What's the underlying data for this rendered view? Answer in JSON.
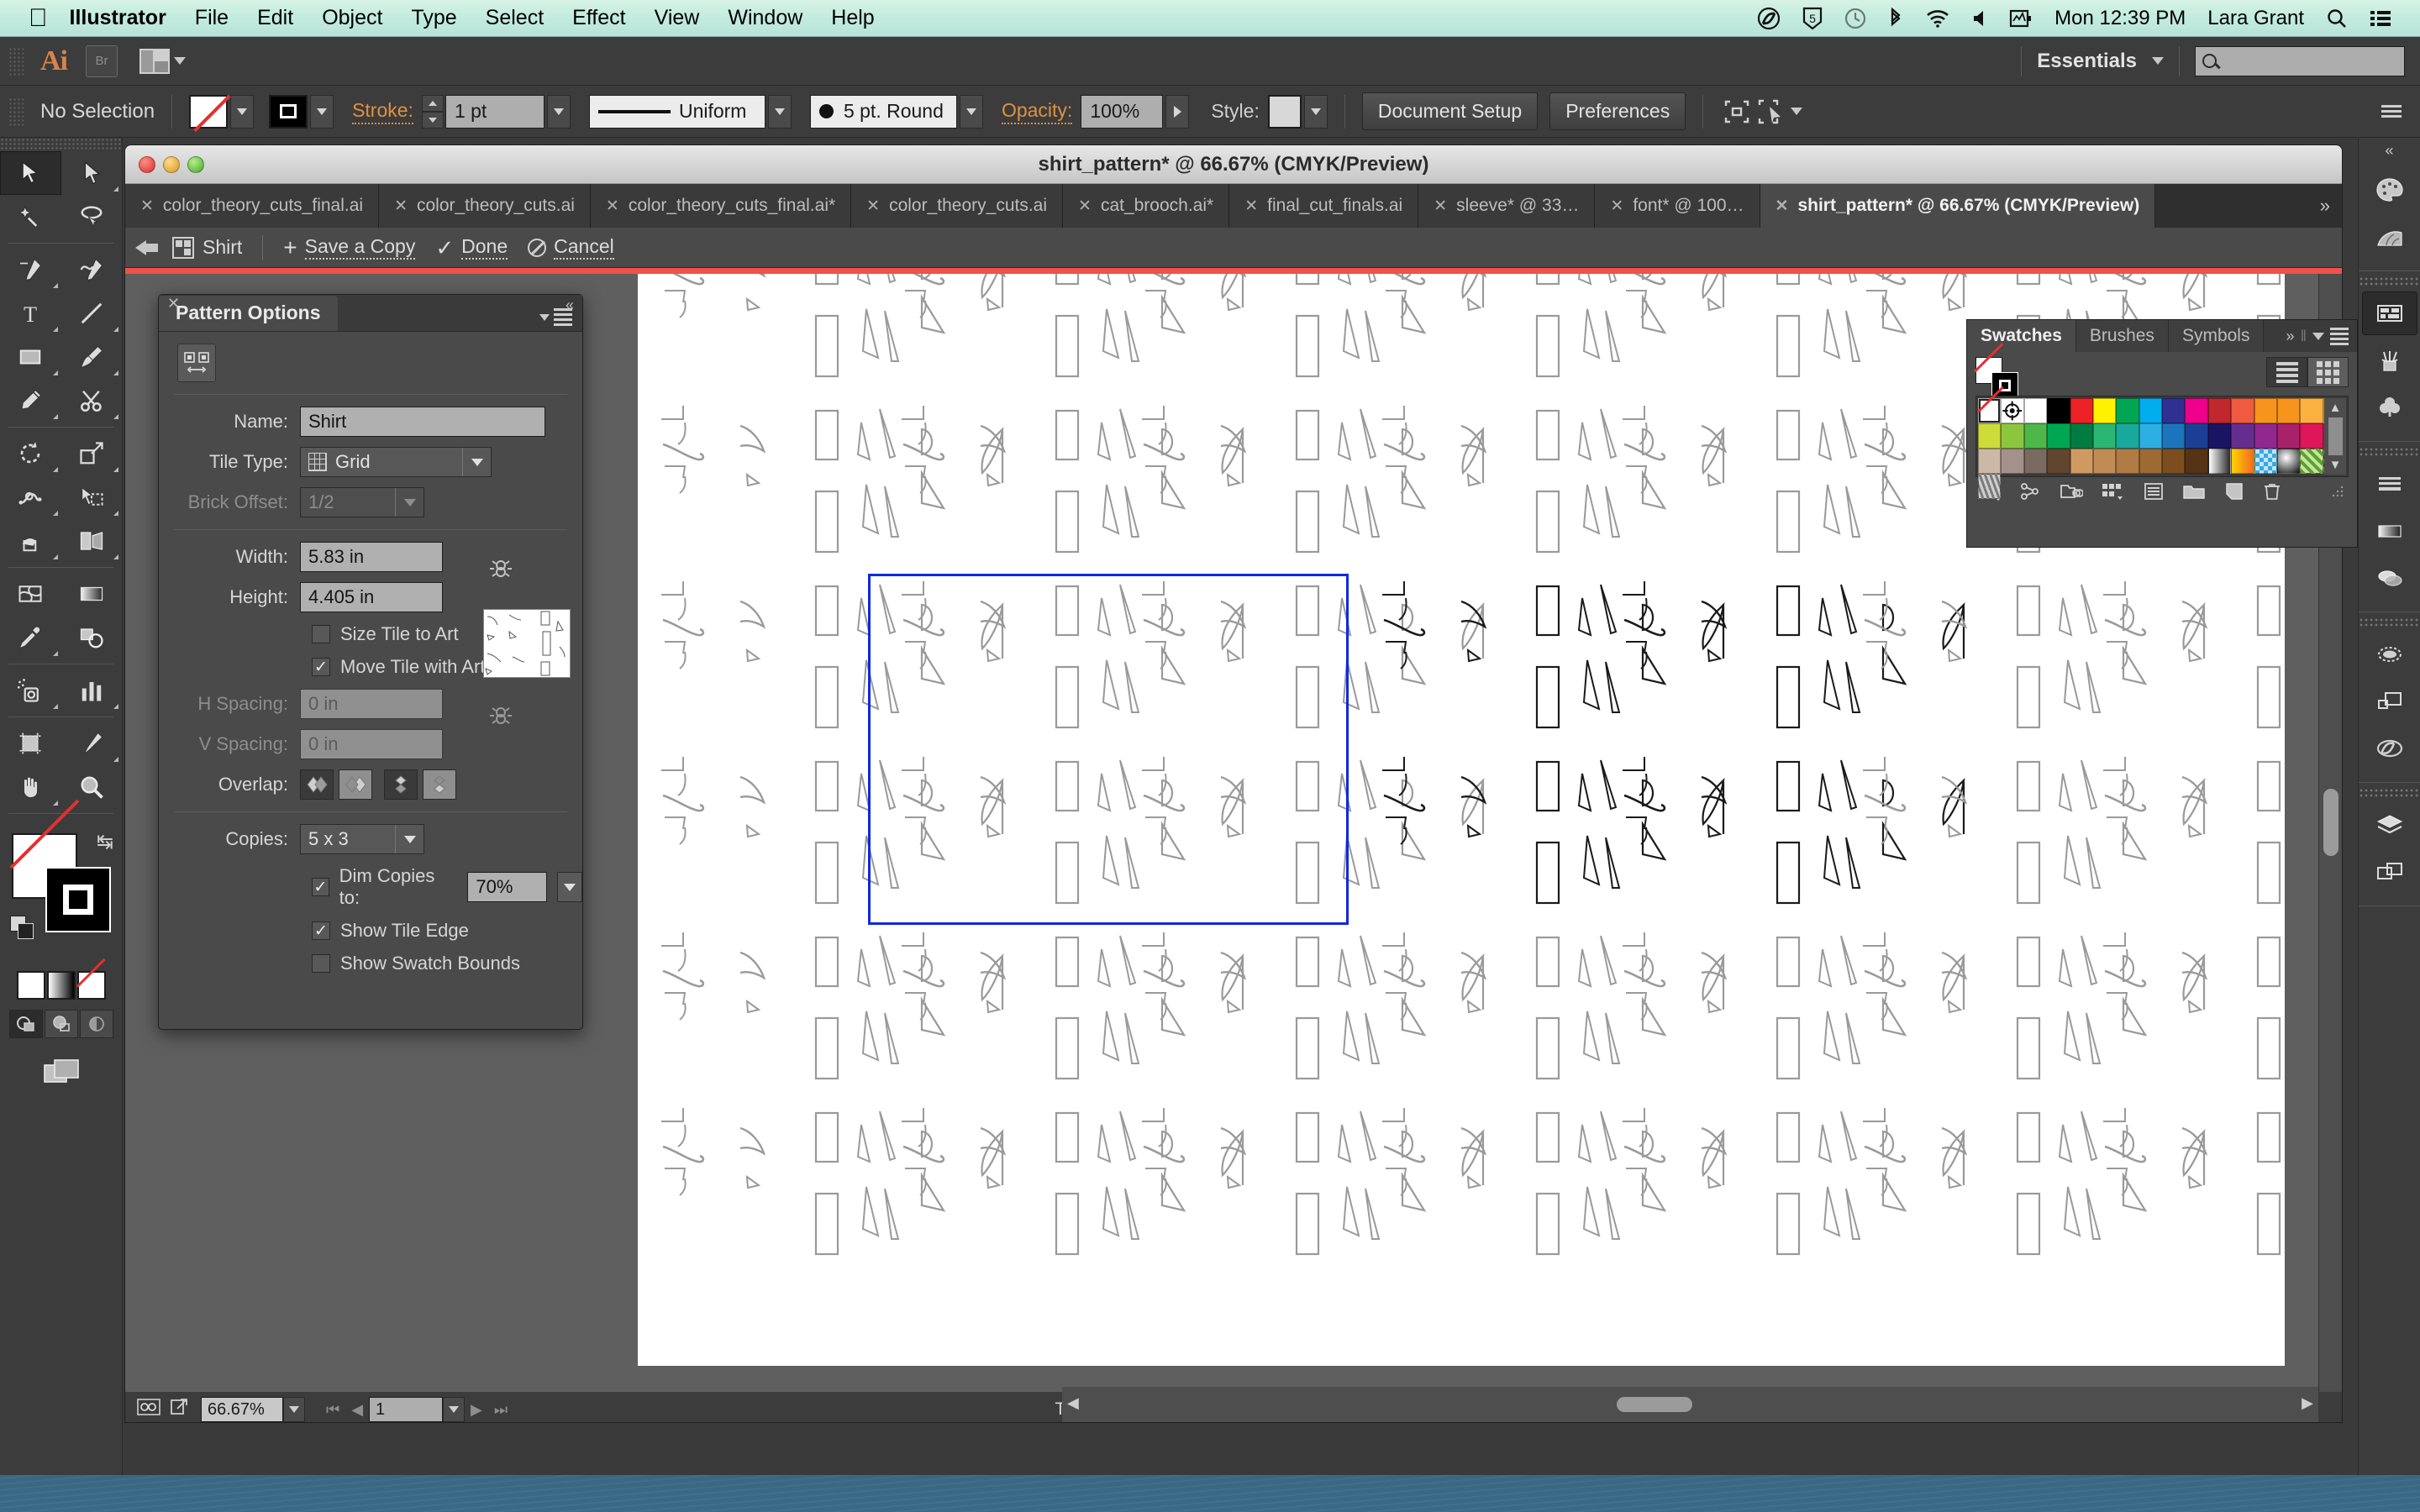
{
  "macbar": {
    "apple": "apple-logo",
    "menus": [
      "Illustrator",
      "File",
      "Edit",
      "Object",
      "Type",
      "Select",
      "Effect",
      "View",
      "Window",
      "Help"
    ],
    "status_icons": [
      "creative-cloud-icon",
      "shield-5-icon",
      "time-machine-icon",
      "bluetooth-icon",
      "wifi-icon",
      "volume-icon",
      "activity-monitor-icon"
    ],
    "clock": "Mon 12:39 PM",
    "user": "Lara Grant",
    "search_icon": "spotlight-search-icon",
    "notification_icon": "notification-center-icon"
  },
  "appbar": {
    "logo": "Ai",
    "bridge_label": "Br",
    "arrange_icon": "arrange-documents-icon",
    "workspace": "Essentials",
    "search_placeholder": ""
  },
  "control_bar": {
    "selection_status": "No Selection",
    "fill_label": "fill-swatch",
    "stroke_color_label": "stroke-swatch",
    "stroke_label": "Stroke:",
    "stroke_weight": "1 pt",
    "stroke_profile": "Uniform",
    "brush_definition": "5 pt. Round",
    "opacity_label": "Opacity:",
    "opacity_value": "100%",
    "style_label": "Style:",
    "document_setup": "Document Setup",
    "preferences": "Preferences",
    "transform_icon": "transform-icon",
    "align_icon": "align-icon"
  },
  "document_window": {
    "title": "shirt_pattern* @ 66.67% (CMYK/Preview)",
    "tabs": [
      {
        "label": "color_theory_cuts_final.ai",
        "active": false
      },
      {
        "label": "color_theory_cuts.ai",
        "active": false
      },
      {
        "label": "color_theory_cuts_final.ai*",
        "active": false
      },
      {
        "label": "color_theory_cuts.ai",
        "active": false
      },
      {
        "label": "cat_brooch.ai*",
        "active": false
      },
      {
        "label": "final_cut_finals.ai",
        "active": false
      },
      {
        "label": "sleeve* @ 33…",
        "active": false
      },
      {
        "label": "font* @ 100…",
        "active": false
      },
      {
        "label": "shirt_pattern* @ 66.67% (CMYK/Preview)",
        "active": true
      }
    ],
    "tab_close": "✕",
    "tab_overflow": "»"
  },
  "pattern_edit_bar": {
    "back_icon": "back-arrow-icon",
    "pattern_icon": "pattern-tile-icon",
    "pattern_name": "Shirt",
    "save_copy": "Save a Copy",
    "done": "Done",
    "cancel": "Cancel"
  },
  "pattern_options": {
    "panel_title": "Pattern Options",
    "close_icon": "close-icon",
    "collapse_icon": "collapse-icon",
    "menu_icon": "panel-menu-icon",
    "tile_tool_icon": "pattern-tile-tool-icon",
    "fields": {
      "name_label": "Name:",
      "name_value": "Shirt",
      "tile_type_label": "Tile Type:",
      "tile_type_value": "Grid",
      "brick_offset_label": "Brick Offset:",
      "brick_offset_value": "1/2",
      "width_label": "Width:",
      "width_value": "5.83 in",
      "height_label": "Height:",
      "height_value": "4.405 in",
      "h_spacing_label": "H Spacing:",
      "h_spacing_value": "0 in",
      "v_spacing_label": "V Spacing:",
      "v_spacing_value": "0 in",
      "overlap_label": "Overlap:",
      "copies_label": "Copies:",
      "copies_value": "5 x 3",
      "dim_copies_label": "Dim Copies to:",
      "dim_copies_value": "70%"
    },
    "checkboxes": [
      {
        "label": "Size Tile to Art",
        "checked": false
      },
      {
        "label": "Move Tile with Art",
        "checked": true
      },
      {
        "label": "Dim Copies to:",
        "checked": true
      },
      {
        "label": "Show Tile Edge",
        "checked": true
      },
      {
        "label": "Show Swatch Bounds",
        "checked": false
      }
    ],
    "overlap_buttons": [
      "overlap-left-icon",
      "overlap-right-icon",
      "overlap-top-icon",
      "overlap-bottom-icon"
    ],
    "link_icon": "link-dimensions-icon"
  },
  "swatches_panel": {
    "tabs": [
      "Swatches",
      "Brushes",
      "Symbols"
    ],
    "active_tab": "Swatches",
    "expand_icon": "expand-panels-icon",
    "menu_icon": "panel-menu-icon",
    "view_list_icon": "list-view-icon",
    "view_grid_icon": "grid-view-icon",
    "fill_icon": "fill-none-swatch",
    "stroke_icon": "stroke-black-swatch",
    "colors": [
      "none",
      "registration",
      "#ffffff",
      "#000000",
      "#ec2227",
      "#fff200",
      "#00a651",
      "#00aeef",
      "#2e3192",
      "#ec008c",
      "#c1272d",
      "#f05a40",
      "#f7941e",
      "#f7941e",
      "#fbb040",
      "#f9ed32",
      "#cddc39",
      "#8cc63f",
      "#4cb84a",
      "#00a651",
      "#007c42",
      "#2bb673",
      "#17a99c",
      "#2eafe4",
      "#1b75bc",
      "#1b3f94",
      "#1b1464",
      "#662d91",
      "#92278f",
      "#a8216b",
      "#e0165b",
      "#ec1f8d",
      "#cbb9a5",
      "#a3918a",
      "#7b6a5f",
      "#62452f",
      "#cf9a62",
      "#c08c54",
      "#b07a44",
      "#9d6a34",
      "#7c4e1e",
      "#563314",
      "gradient-white-black",
      "gradient-yellow-orange",
      "pattern-blue-checks",
      "pattern-sphere",
      "pattern-green-leaves",
      "pattern-brown-scroll",
      "pattern-camouflage"
    ],
    "footer_icons": [
      "swatch-libraries-icon",
      "color-group-icon",
      "link-libraries-icon",
      "show-kinds-icon",
      "swatch-options-icon",
      "new-color-group-icon",
      "new-swatch-icon",
      "delete-swatch-icon"
    ],
    "scroll_up_icon": "scroll-up-arrow",
    "scroll_down_icon": "scroll-down-arrow"
  },
  "icon_dock": {
    "groups": [
      [
        "color-palette-icon",
        "color-guide-icon"
      ],
      [
        "artboards-icon",
        "brushes-jar-icon",
        "symbols-clover-icon"
      ],
      [
        "stroke-lines-icon",
        "gradient-icon",
        "transparency-icon"
      ],
      [
        "appearance-ellipse-icon",
        "graphic-styles-icon",
        "creative-cloud-libraries-icon"
      ],
      [
        "layers-icon",
        "artboards-panel-icon"
      ]
    ],
    "collapse_icon": "collapse-dock-icon"
  },
  "tool_panel": {
    "tools": [
      {
        "name": "selection-tool",
        "glyph": "selection",
        "selected": true,
        "flyout": false
      },
      {
        "name": "direct-selection-tool",
        "glyph": "direct-selection",
        "selected": false,
        "flyout": true
      },
      {
        "name": "magic-wand-tool",
        "glyph": "magic-wand",
        "selected": false,
        "flyout": false
      },
      {
        "name": "lasso-tool",
        "glyph": "lasso",
        "selected": false,
        "flyout": false
      },
      {
        "name": "pen-tool",
        "glyph": "pen",
        "selected": false,
        "flyout": true
      },
      {
        "name": "curvature-tool",
        "glyph": "curvature",
        "selected": false,
        "flyout": false
      },
      {
        "name": "type-tool",
        "glyph": "type",
        "selected": false,
        "flyout": true
      },
      {
        "name": "line-segment-tool",
        "glyph": "line",
        "selected": false,
        "flyout": true
      },
      {
        "name": "rectangle-tool",
        "glyph": "rectangle",
        "selected": false,
        "flyout": true
      },
      {
        "name": "paintbrush-tool",
        "glyph": "paintbrush",
        "selected": false,
        "flyout": true
      },
      {
        "name": "pencil-tool",
        "glyph": "pencil",
        "selected": false,
        "flyout": true
      },
      {
        "name": "scissors-tool",
        "glyph": "scissors",
        "selected": false,
        "flyout": true
      },
      {
        "name": "rotate-tool",
        "glyph": "rotate",
        "selected": false,
        "flyout": true
      },
      {
        "name": "scale-tool",
        "glyph": "scale",
        "selected": false,
        "flyout": true
      },
      {
        "name": "width-tool",
        "glyph": "width",
        "selected": false,
        "flyout": true
      },
      {
        "name": "free-transform-tool",
        "glyph": "free-transform",
        "selected": false,
        "flyout": false
      },
      {
        "name": "shape-builder-tool",
        "glyph": "shape-builder",
        "selected": false,
        "flyout": true
      },
      {
        "name": "perspective-grid-tool",
        "glyph": "perspective",
        "selected": false,
        "flyout": true
      },
      {
        "name": "mesh-tool",
        "glyph": "mesh",
        "selected": false,
        "flyout": false
      },
      {
        "name": "gradient-tool",
        "glyph": "gradient",
        "selected": false,
        "flyout": false
      },
      {
        "name": "eyedropper-tool",
        "glyph": "eyedropper",
        "selected": false,
        "flyout": true
      },
      {
        "name": "blend-tool",
        "glyph": "blend",
        "selected": false,
        "flyout": false
      },
      {
        "name": "symbol-sprayer-tool",
        "glyph": "symbol-sprayer",
        "selected": false,
        "flyout": true
      },
      {
        "name": "column-graph-tool",
        "glyph": "graph",
        "selected": false,
        "flyout": true
      },
      {
        "name": "artboard-tool",
        "glyph": "artboard",
        "selected": false,
        "flyout": false
      },
      {
        "name": "slice-tool",
        "glyph": "slice",
        "selected": false,
        "flyout": true
      },
      {
        "name": "hand-tool",
        "glyph": "hand",
        "selected": false,
        "flyout": true
      },
      {
        "name": "zoom-tool",
        "glyph": "zoom",
        "selected": false,
        "flyout": false
      }
    ],
    "fill_swatch": "fill-none",
    "stroke_swatch": "stroke-black",
    "swap_icon": "swap-fill-stroke-icon",
    "default_icon": "default-fill-stroke-icon",
    "draw_modes": [
      "draw-normal-icon",
      "draw-behind-icon",
      "draw-inside-icon"
    ],
    "color_modes": [
      "color-white-icon",
      "gradient-icon",
      "none-icon"
    ],
    "screen_mode": "change-screen-mode-icon"
  },
  "status_bar": {
    "preview_icon": "preview-icon",
    "share_icon": "share-icon",
    "zoom_value": "66.67%",
    "page_value": "1",
    "status_text": "Toggle Direct Selection",
    "first_icon": "first-page-icon",
    "prev_icon": "prev-page-icon",
    "next_icon": "next-page-icon",
    "last_icon": "last-page-icon",
    "expand_icon": "expand-status-icon"
  },
  "artwork": {
    "description": "shirt pattern tile with abstract line motifs",
    "tile_edge_color": "#1028e0",
    "stroke_color": "#1a1a1a",
    "dim_stroke_color": "#9a9a9a"
  }
}
